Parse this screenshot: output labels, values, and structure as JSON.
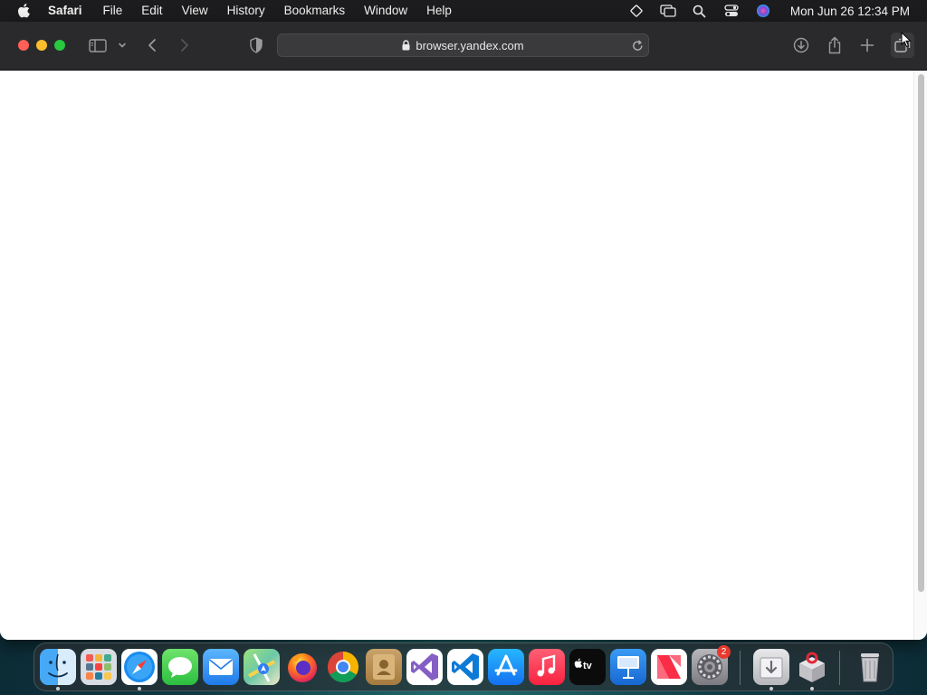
{
  "menubar": {
    "app_name": "Safari",
    "items": [
      "File",
      "Edit",
      "View",
      "History",
      "Bookmarks",
      "Window",
      "Help"
    ],
    "clock": "Mon Jun 26  12:34 PM"
  },
  "browser": {
    "url": "browser.yandex.com"
  },
  "dock": {
    "apps": [
      "Finder",
      "Launchpad",
      "Safari",
      "Messages",
      "Mail",
      "Maps",
      "Firefox",
      "Google Chrome",
      "Contacts",
      "Visual Studio",
      "Visual Studio Code",
      "App Store",
      "Music",
      "Apple TV",
      "Keynote",
      "News",
      "System Settings"
    ],
    "settings_badge": "2",
    "extra": [
      "Downloads",
      "Archive Utility",
      "Trash"
    ]
  },
  "colors": {
    "toolbar": "#2a2a2c",
    "menubar": "#1c1c1e",
    "close": "#ff5f57",
    "minimize": "#febc2e",
    "zoom": "#28c840"
  }
}
